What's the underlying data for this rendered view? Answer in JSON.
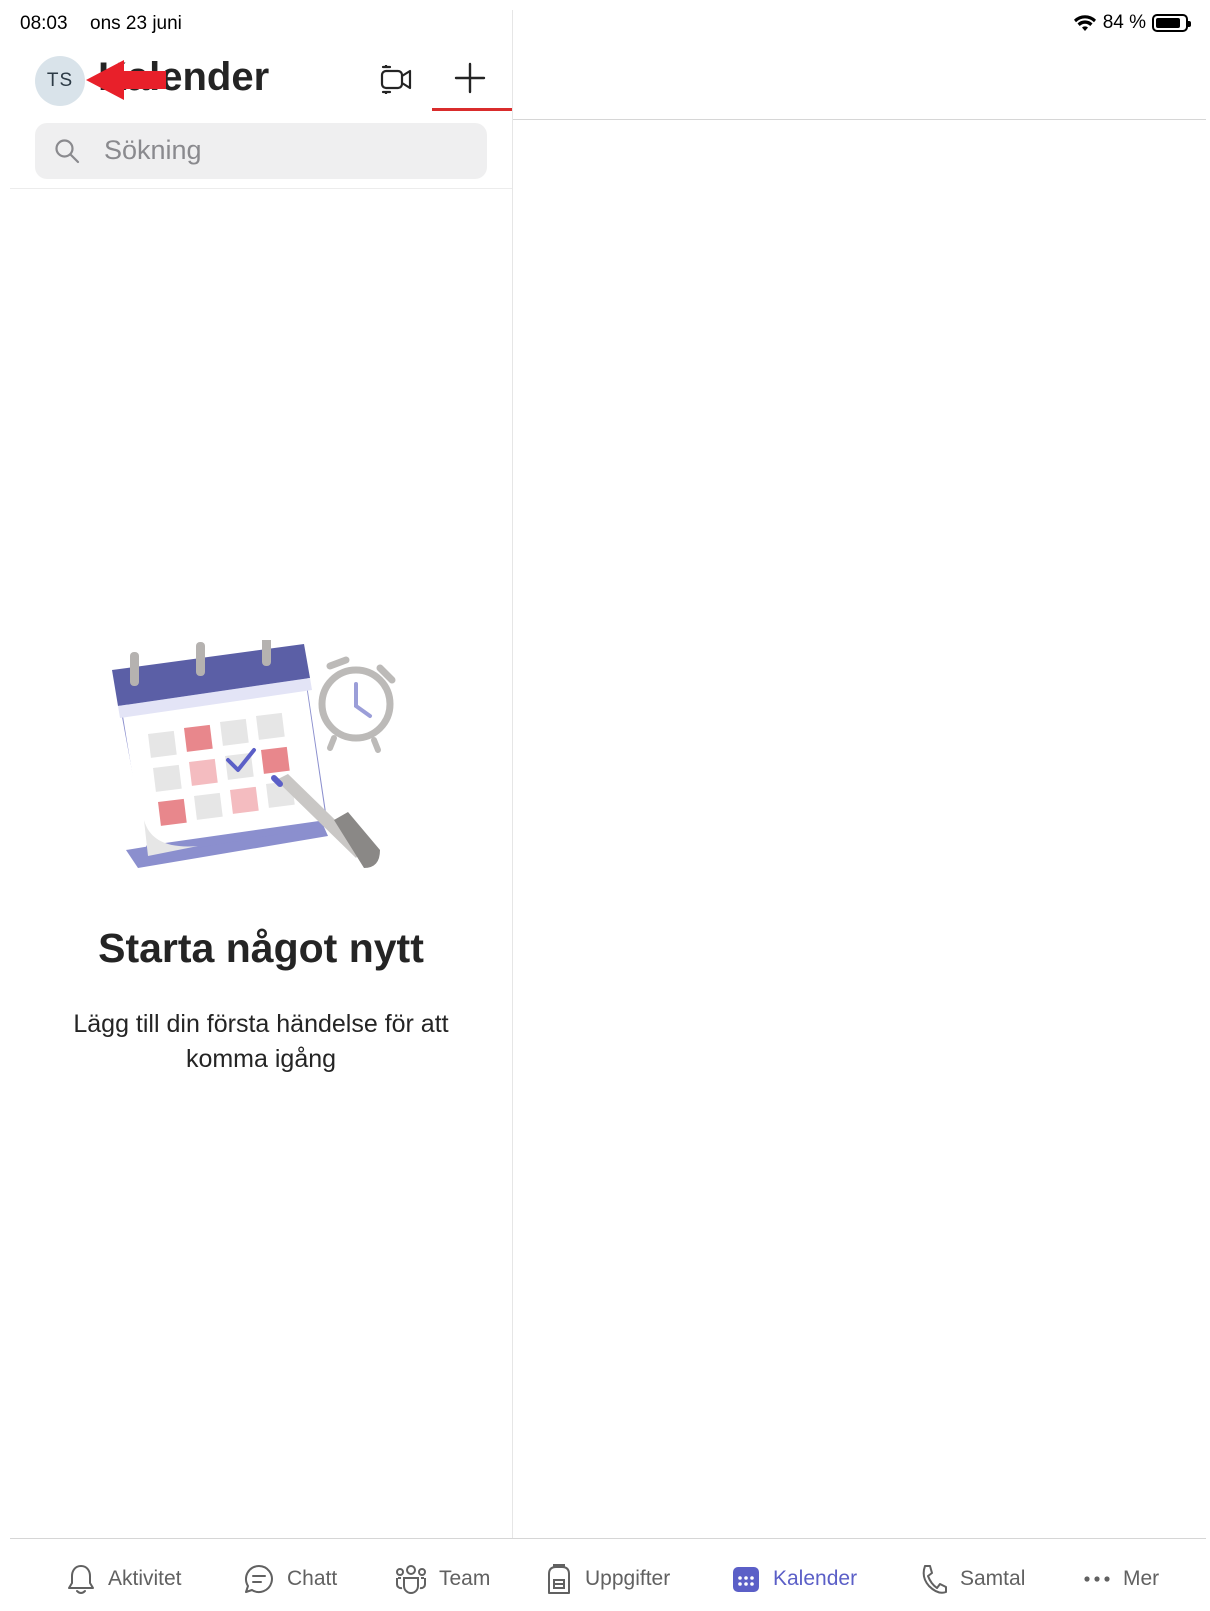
{
  "status_bar": {
    "time": "08:03",
    "date": "ons 23 juni",
    "battery": "84 %",
    "battery_level": 0.84
  },
  "header": {
    "avatar_initials": "TS",
    "title": "Kalender"
  },
  "search": {
    "placeholder": "Sökning"
  },
  "empty_state": {
    "title": "Starta något nytt",
    "subtitle": "Lägg till din första händelse för att komma igång"
  },
  "tabbar": {
    "items": [
      {
        "label": "Aktivitet",
        "icon": "bell-icon"
      },
      {
        "label": "Chatt",
        "icon": "chat-icon"
      },
      {
        "label": "Team",
        "icon": "team-icon"
      },
      {
        "label": "Uppgifter",
        "icon": "tasks-icon"
      },
      {
        "label": "Kalender",
        "icon": "calendar-icon",
        "active": true
      },
      {
        "label": "Samtal",
        "icon": "phone-icon"
      },
      {
        "label": "Mer",
        "icon": "more-icon"
      }
    ]
  },
  "colors": {
    "accent": "#5b5fc7",
    "annotation": "#e8202a",
    "underline": "#d92c2c"
  }
}
